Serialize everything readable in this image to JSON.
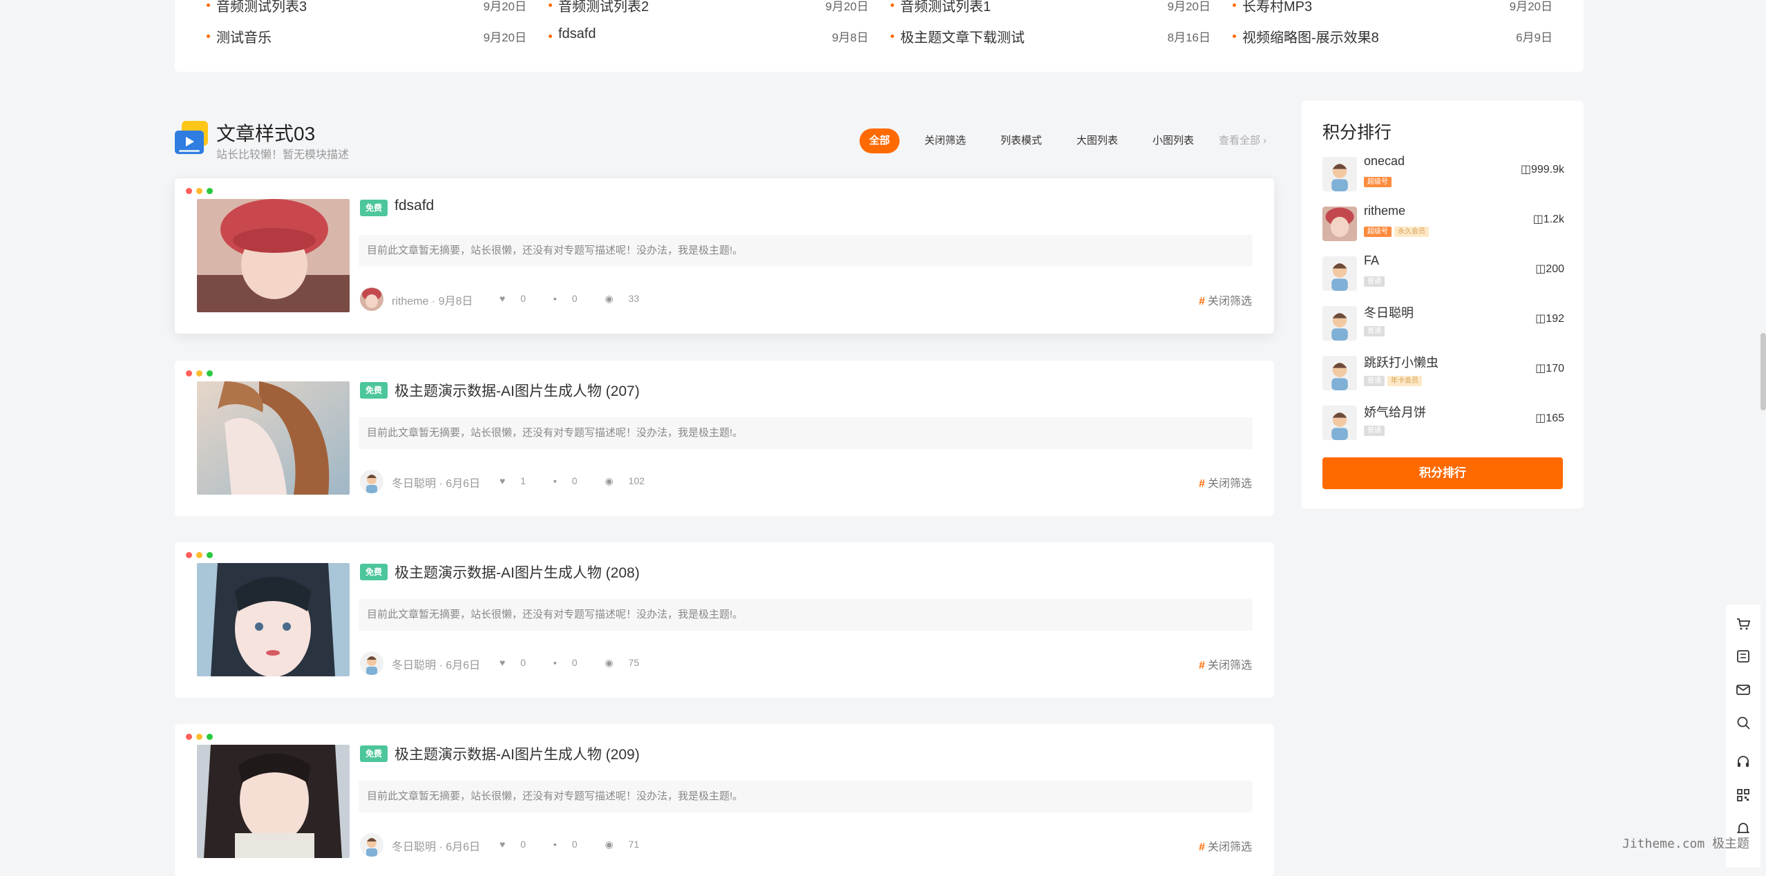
{
  "top_list": {
    "rows": [
      [
        {
          "title": "音频测试列表3",
          "date": "9月20日"
        },
        {
          "title": "音频测试列表2",
          "date": "9月20日"
        },
        {
          "title": "音频测试列表1",
          "date": "9月20日"
        },
        {
          "title": "长寿村MP3",
          "date": "9月20日"
        }
      ],
      [
        {
          "title": "测试音乐",
          "date": "9月20日"
        },
        {
          "title": "fdsafd",
          "date": "9月8日"
        },
        {
          "title": "极主题文章下载测试",
          "date": "8月16日"
        },
        {
          "title": "视频缩略图-展示效果8",
          "date": "6月9日"
        }
      ]
    ]
  },
  "module": {
    "title": "文章样式03",
    "description": "站长比较懒！暂无模块描述",
    "tabs": [
      "全部",
      "关闭筛选",
      "列表模式",
      "大图列表",
      "小图列表"
    ],
    "view_all": "查看全部 ›"
  },
  "articles": [
    {
      "badge": "免费",
      "title": "fdsafd",
      "excerpt": "目前此文章暂无摘要，站长很懒，还没有对专题写描述呢！没办法，我是极主题!。",
      "author": "ritheme",
      "date": "9月8日",
      "likes": "0",
      "comments": "0",
      "views": "33",
      "tag": "关闭筛选"
    },
    {
      "badge": "免费",
      "title": "极主题演示数据-AI图片生成人物 (207)",
      "excerpt": "目前此文章暂无摘要，站长很懒，还没有对专题写描述呢！没办法，我是极主题!。",
      "author": "冬日聪明",
      "date": "6月6日",
      "likes": "1",
      "comments": "0",
      "views": "102",
      "tag": "关闭筛选"
    },
    {
      "badge": "免费",
      "title": "极主题演示数据-AI图片生成人物 (208)",
      "excerpt": "目前此文章暂无摘要，站长很懒，还没有对专题写描述呢！没办法，我是极主题!。",
      "author": "冬日聪明",
      "date": "6月6日",
      "likes": "0",
      "comments": "0",
      "views": "75",
      "tag": "关闭筛选"
    },
    {
      "badge": "免费",
      "title": "极主题演示数据-AI图片生成人物 (209)",
      "excerpt": "目前此文章暂无摘要，站长很懒，还没有对专题写描述呢！没办法，我是极主题!。",
      "author": "冬日聪明",
      "date": "6月6日",
      "likes": "0",
      "comments": "0",
      "views": "71",
      "tag": "关闭筛选"
    }
  ],
  "sidebar": {
    "title": "积分排行",
    "button": "积分排行",
    "ranking": [
      {
        "name": "onecad",
        "badges": [
          "超级号"
        ],
        "score": "999.9k"
      },
      {
        "name": "ritheme",
        "badges": [
          "超级号",
          "永久会员"
        ],
        "score": "1.2k"
      },
      {
        "name": "FA",
        "badges": [
          "普通"
        ],
        "score": "200"
      },
      {
        "name": "冬日聪明",
        "badges": [
          "普通"
        ],
        "score": "192"
      },
      {
        "name": "跳跃打小懒虫",
        "badges": [
          "普通",
          "年卡会员"
        ],
        "score": "170"
      },
      {
        "name": "娇气给月饼",
        "badges": [
          "普通"
        ],
        "score": "165"
      }
    ]
  },
  "float_toolbar": {
    "icons": [
      "cart-icon",
      "ticket-icon",
      "mail-icon",
      "search-icon",
      "headset-icon",
      "qrcode-icon",
      "bell-icon"
    ]
  },
  "watermark": "Jitheme.com 极主题",
  "colors": {
    "accent": "#ff6a00",
    "free_badge": "#4cc69a",
    "background": "#f4f5f7"
  }
}
